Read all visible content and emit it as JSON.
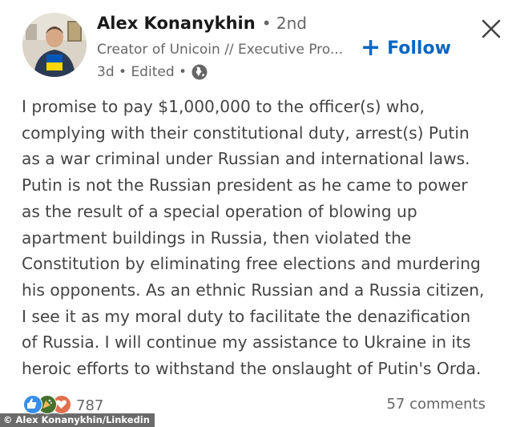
{
  "author": {
    "name": "Alex Konanykhin",
    "degree": "• 2nd",
    "headline": "Creator of Unicoin // Executive Pro...",
    "meta": "3d • Edited •",
    "avatar_icon": "profile-photo",
    "globe_icon": "globe-icon"
  },
  "actions": {
    "follow_label": "Follow",
    "follow_plus": "+",
    "close_icon": "close-icon",
    "accent_color": "#0a66c2"
  },
  "post": {
    "lines": [
      "I promise to pay $1,000,000 to the officer(s) who,",
      "complying with their constitutional duty, arrest(s) Putin",
      "as a war criminal under Russian and international laws.",
      "Putin is not the Russian president as he came to power",
      "as the result of a special operation of blowing up",
      "apartment buildings in Russia, then violated the",
      "Constitution by eliminating free elections and murdering",
      "his opponents. As an ethnic Russian and a Russia citizen,",
      "I see it as my moral duty to facilitate the denazification",
      "of Russia. I will continue my assistance to Ukraine in its",
      "heroic efforts to withstand the onslaught of Putin's Orda."
    ]
  },
  "social": {
    "reaction_icons": [
      "like-icon",
      "celebrate-icon",
      "love-icon"
    ],
    "reaction_count": "787",
    "comments_label": "57 comments"
  },
  "credit": "© Alex Konanykhin/Linkedin"
}
